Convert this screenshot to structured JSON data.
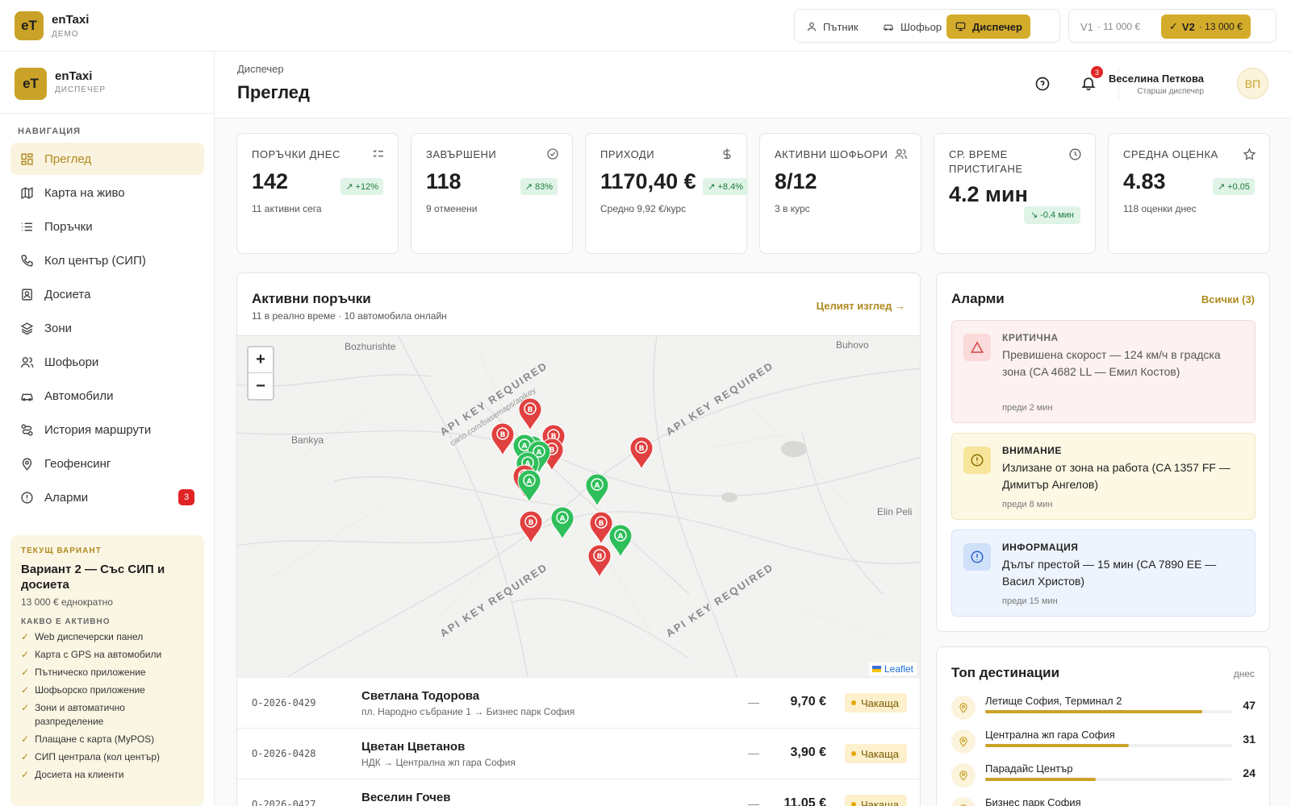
{
  "topbar": {
    "logo": "eT",
    "app_name": "enTaxi",
    "app_sub": "ДЕМО",
    "roles": [
      "Пътник",
      "Шофьор",
      "Диспечер"
    ],
    "versions": [
      {
        "name": "V1",
        "price": "· 11 000 €"
      },
      {
        "name": "V2",
        "price": "· 13 000 €"
      }
    ]
  },
  "sidebar": {
    "logo": "eT",
    "app_name": "enTaxi",
    "app_sub": "ДИСПЕЧЕР",
    "nav_title": "НАВИГАЦИЯ",
    "items": [
      {
        "label": "Преглед",
        "icon": "grid-icon"
      },
      {
        "label": "Карта на живо",
        "icon": "map-icon"
      },
      {
        "label": "Поръчки",
        "icon": "list-icon"
      },
      {
        "label": "Кол център (СИП)",
        "icon": "phone-icon"
      },
      {
        "label": "Досиета",
        "icon": "contact-icon"
      },
      {
        "label": "Зони",
        "icon": "layers-icon"
      },
      {
        "label": "Шофьори",
        "icon": "users-icon"
      },
      {
        "label": "Автомобили",
        "icon": "car-icon"
      },
      {
        "label": "История маршрути",
        "icon": "route-icon"
      },
      {
        "label": "Геофенсинг",
        "icon": "pin-icon"
      },
      {
        "label": "Аларми",
        "icon": "alert-icon",
        "badge": "3"
      }
    ],
    "plan": {
      "label": "ТЕКУЩ ВАРИАНТ",
      "title": "Вариант 2 — Със СИП и досиета",
      "price": "13 000 € еднократно",
      "active_label": "КАКВО Е АКТИВНО",
      "features": [
        "Web диспечерски панел",
        "Карта с GPS на автомобили",
        "Пътническо приложение",
        "Шофьорско приложение",
        "Зони и автоматично разпределение",
        "Плащане с карта (MyPOS)",
        "СИП централа (кол център)",
        "Досиета на клиенти"
      ]
    }
  },
  "header": {
    "breadcrumb": "Диспечер",
    "title": "Преглед",
    "notifications": "3",
    "user_name": "Веселина Петкова",
    "user_role": "Старши диспечер",
    "user_initials": "ВП"
  },
  "kpis": [
    {
      "label": "ПОРЪЧКИ ДНЕС",
      "value": "142",
      "trend": "+12%",
      "sub": "11 активни сега",
      "icon": "checklist-icon"
    },
    {
      "label": "ЗАВЪРШЕНИ",
      "value": "118",
      "trend": "83%",
      "sub": "9 отменени",
      "icon": "check-circle-icon"
    },
    {
      "label": "ПРИХОДИ",
      "value": "1170,40 €",
      "trend": "+8.4%",
      "sub": "Средно 9,92 €/курс",
      "icon": "dollar-icon"
    },
    {
      "label": "АКТИВНИ ШОФЬОРИ",
      "value": "8/12",
      "trend": "",
      "sub": "3 в курс",
      "icon": "users-icon"
    },
    {
      "label": "СР. ВРЕМЕ ПРИСТИГАНЕ",
      "value": "4.2 мин",
      "trend": "-0.4 мин",
      "sub": "",
      "icon": "clock-icon"
    },
    {
      "label": "СРЕДНА ОЦЕНКА",
      "value": "4.83",
      "trend": "+0.05",
      "sub": "118 оценки днес",
      "icon": "star-icon"
    }
  ],
  "orders": {
    "title": "Активни поръчки",
    "subtitle": "11 в реално време · 10 автомобила онлайн",
    "link": "Целият изглед",
    "map": {
      "places": [
        "Bozhurishte",
        "Buhovo",
        "Bankya",
        "Elin Peli"
      ],
      "watermark": "API KEY REQUIRED",
      "watermark_url": "carto.com/basemaps/apikey",
      "attribution": "Leaflet",
      "zoom_in": "+",
      "zoom_out": "−"
    },
    "rows": [
      {
        "id": "O-2026-0429",
        "name": "Светлана Тодорова",
        "route": "пл. Народно събрание 1 → Бизнес парк София",
        "dash": "—",
        "price": "9,70 €",
        "status": "Чакаща"
      },
      {
        "id": "O-2026-0428",
        "name": "Цветан Цветанов",
        "route": "НДК → Централна жп гара София",
        "dash": "—",
        "price": "3,90 €",
        "status": "Чакаща"
      },
      {
        "id": "O-2026-0427",
        "name": "Веселин Гочев",
        "route": "",
        "dash": "—",
        "price": "11,05 €",
        "status": "Чакаща"
      }
    ]
  },
  "alarms": {
    "title": "Аларми",
    "link": "Всички (3)",
    "items": [
      {
        "level": "КРИТИЧНА",
        "message": "Превишена скорост — 124 км/ч в градска зона (CA 4682 LL — Емил Костов)",
        "time": "преди 2 мин",
        "color": "#e05252"
      },
      {
        "level": "ВНИМАНИЕ",
        "message": "Излизане от зона на работа (CA 1357 FF — Димитър Ангелов)",
        "time": "преди 8 мин",
        "color": "#c9a227"
      },
      {
        "level": "ИНФОРМАЦИЯ",
        "message": "Дълъг престой — 15 мин (CA 7890 EE — Васил Христов)",
        "time": "преди 15 мин",
        "color": "#3b82f6"
      }
    ]
  },
  "destinations": {
    "title": "Топ дестинации",
    "period": "днес",
    "items": [
      {
        "name": "Летище София, Терминал 2",
        "count": "47",
        "share": 1.0
      },
      {
        "name": "Централна жп гара София",
        "count": "31",
        "share": 0.66
      },
      {
        "name": "Парадайс Център",
        "count": "24",
        "share": 0.51
      },
      {
        "name": "Бизнес парк София",
        "count": "",
        "share": 0.4
      }
    ]
  },
  "colors": {
    "accent": "#c9a227",
    "success": "#1e7a3f",
    "danger": "#e02424"
  }
}
